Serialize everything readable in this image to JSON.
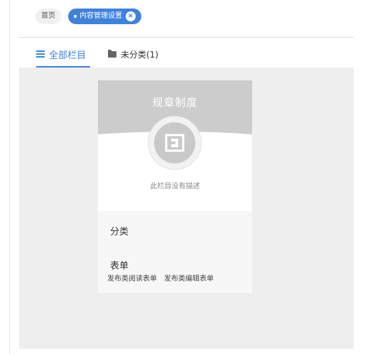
{
  "breadcrumb": {
    "home": "首页",
    "current": "内容管理设置",
    "close_icon": "close-circle-icon"
  },
  "tabs": {
    "all": "全部栏目",
    "uncategorized": "未分类(1)"
  },
  "card": {
    "title": "规章制度",
    "description": "此栏目没有描述",
    "category_label": "分类",
    "form_label": "表单",
    "forms": [
      "发布类阅读表单",
      "发布类编辑表单"
    ],
    "banner_color": "#cccccc",
    "icon": "column-square-icon"
  },
  "colors": {
    "accent": "#3f82dc",
    "content_bg": "#eeeeee"
  }
}
